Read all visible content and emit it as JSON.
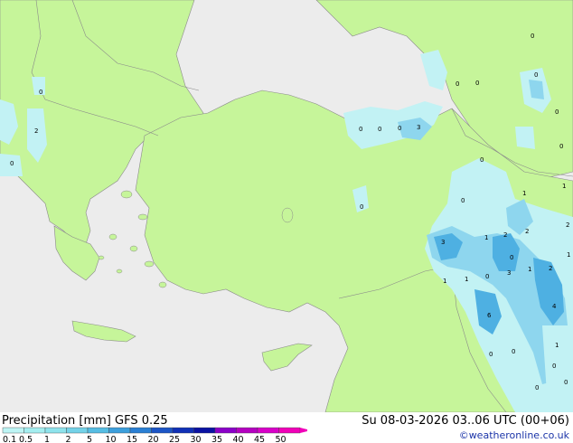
{
  "footer": {
    "title": "Precipitation [mm]  GFS 0.25",
    "datetime": "Su 08-03-2026 03..06 UTC (00+06)",
    "credit": "©weatheronline.co.uk"
  },
  "legend": {
    "levels": [
      "0.1",
      "0.5",
      "1",
      "2",
      "5",
      "10",
      "15",
      "20",
      "25",
      "30",
      "35",
      "40",
      "45",
      "50"
    ],
    "colors": [
      "#bdf5f5",
      "#a4eef0",
      "#8ee3ec",
      "#74d2e8",
      "#56bde3",
      "#3c9fdc",
      "#2a7fd4",
      "#1c55c6",
      "#1030b6",
      "#0a12a2",
      "#8a00c8",
      "#b400c0",
      "#d800c8",
      "#f000b8"
    ]
  },
  "map_colors": {
    "sea": "#ececec",
    "land": "#c6f59a",
    "border": "#8a8a8a",
    "precip_light": "#c2f2f4",
    "precip_mid": "#8ed6ee",
    "precip_heavy": "#4eb0e2"
  },
  "precip_labels": [
    "0",
    "2",
    "0",
    "0",
    "3",
    "0",
    "0",
    "0",
    "0",
    "0",
    "0",
    "0",
    "0",
    "0",
    "0",
    "1",
    "1",
    "1",
    "2",
    "2",
    "3",
    "1",
    "2",
    "3",
    "1",
    "0",
    "1",
    "2",
    "1",
    "0",
    "6",
    "4",
    "0",
    "0",
    "1",
    "0",
    "0",
    "0",
    "0"
  ]
}
